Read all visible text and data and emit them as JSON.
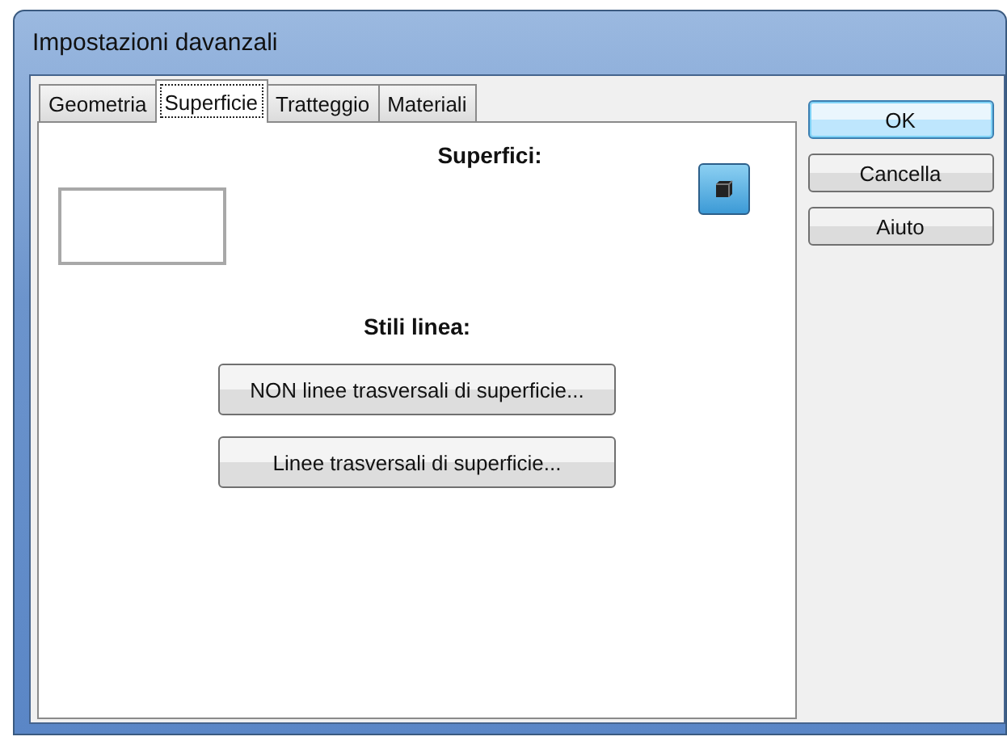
{
  "window": {
    "title": "Impostazioni davanzali"
  },
  "tabs": [
    {
      "label": "Geometria",
      "selected": false
    },
    {
      "label": "Superficie",
      "selected": true
    },
    {
      "label": "Tratteggio",
      "selected": false
    },
    {
      "label": "Materiali",
      "selected": false
    }
  ],
  "panel": {
    "surfaces_label": "Superfici:",
    "line_styles_label": "Stili linea:",
    "line_buttons": [
      "NON linee trasversali di superficie...",
      "Linee trasversali di superficie..."
    ]
  },
  "buttons": [
    {
      "label": "OK",
      "default": true
    },
    {
      "label": "Cancella",
      "default": false
    },
    {
      "label": "Aiuto",
      "default": false
    }
  ]
}
